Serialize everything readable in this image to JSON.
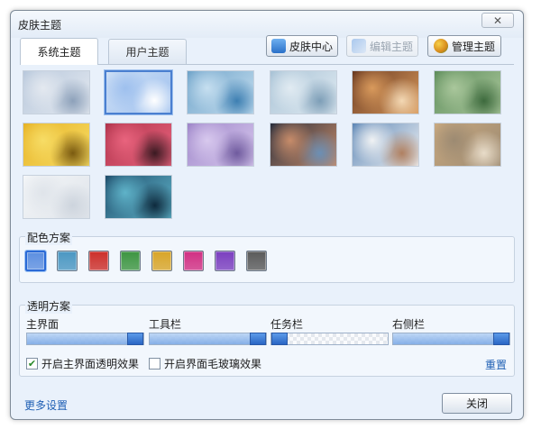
{
  "window": {
    "title": "皮肤主题",
    "close_glyph": "✕"
  },
  "tabs": [
    {
      "label": "系统主题",
      "active": true
    },
    {
      "label": "用户主题",
      "active": false
    }
  ],
  "toolbar": {
    "skin_center": {
      "label": "皮肤中心",
      "icon": "skin-center-icon"
    },
    "edit_theme": {
      "label": "编辑主题",
      "icon": "brush-icon",
      "disabled": true
    },
    "manage_theme": {
      "label": "管理主题",
      "icon": "palette-icon"
    }
  },
  "themes": [
    {
      "name": "theme-1",
      "colors": [
        "#b8c8dc",
        "#e4e9f0",
        "#8da1ba"
      ]
    },
    {
      "name": "theme-2",
      "colors": [
        "#cfe0f6",
        "#9ec0ee",
        "#ffffff"
      ],
      "selected": true
    },
    {
      "name": "theme-3",
      "colors": [
        "#6fa3c9",
        "#c6dff0",
        "#3d7fb2"
      ]
    },
    {
      "name": "theme-4",
      "colors": [
        "#a9c3d6",
        "#e1ebf2",
        "#7d9eb7"
      ]
    },
    {
      "name": "theme-5",
      "colors": [
        "#6a3a22",
        "#d99a5c",
        "#f3d8b4"
      ]
    },
    {
      "name": "theme-6",
      "colors": [
        "#5f8e5c",
        "#aac79c",
        "#3d6a3d"
      ]
    },
    {
      "name": "theme-7",
      "colors": [
        "#e7b326",
        "#f7dd66",
        "#7a5a10"
      ]
    },
    {
      "name": "theme-8",
      "colors": [
        "#b0344c",
        "#e9647e",
        "#3a1a22"
      ]
    },
    {
      "name": "theme-9",
      "colors": [
        "#9e86c9",
        "#d8c9ee",
        "#6f5a9e"
      ]
    },
    {
      "name": "theme-10",
      "colors": [
        "#2a2f3d",
        "#c78c6a",
        "#6b8fb5"
      ]
    },
    {
      "name": "theme-11",
      "colors": [
        "#5e87b6",
        "#f0f2f4",
        "#b08060"
      ]
    },
    {
      "name": "theme-12",
      "colors": [
        "#c9a980",
        "#9c8a72",
        "#e8dcc9"
      ]
    },
    {
      "name": "theme-13",
      "colors": [
        "#f4f6f8",
        "#dfe4ea",
        "#cdd4dd"
      ]
    },
    {
      "name": "theme-14",
      "colors": [
        "#1f4d6b",
        "#5fb3c9",
        "#0e2a3d"
      ]
    }
  ],
  "color_scheme": {
    "label": "配色方案",
    "swatches": [
      {
        "name": "blue",
        "color": "#5d8fe0",
        "selected": true
      },
      {
        "name": "teal",
        "color": "#4b97c2"
      },
      {
        "name": "red",
        "color": "#cc2f2a"
      },
      {
        "name": "green",
        "color": "#3d9541"
      },
      {
        "name": "gold",
        "color": "#d8a528"
      },
      {
        "name": "pink",
        "color": "#d12f83"
      },
      {
        "name": "purple",
        "color": "#7b3fbf"
      },
      {
        "name": "dark",
        "color": "#5a5a5a"
      }
    ]
  },
  "transparency": {
    "label": "透明方案",
    "sliders": [
      {
        "label": "主界面",
        "value": 1.0
      },
      {
        "label": "工具栏",
        "value": 1.0
      },
      {
        "label": "任务栏",
        "value": 0.0
      },
      {
        "label": "右侧栏",
        "value": 1.0
      }
    ],
    "options": [
      {
        "label": "开启主界面透明效果",
        "checked": true
      },
      {
        "label": "开启界面毛玻璃效果",
        "checked": false
      }
    ],
    "reset": "重置"
  },
  "footer": {
    "more_settings": "更多设置",
    "close": "关闭"
  }
}
